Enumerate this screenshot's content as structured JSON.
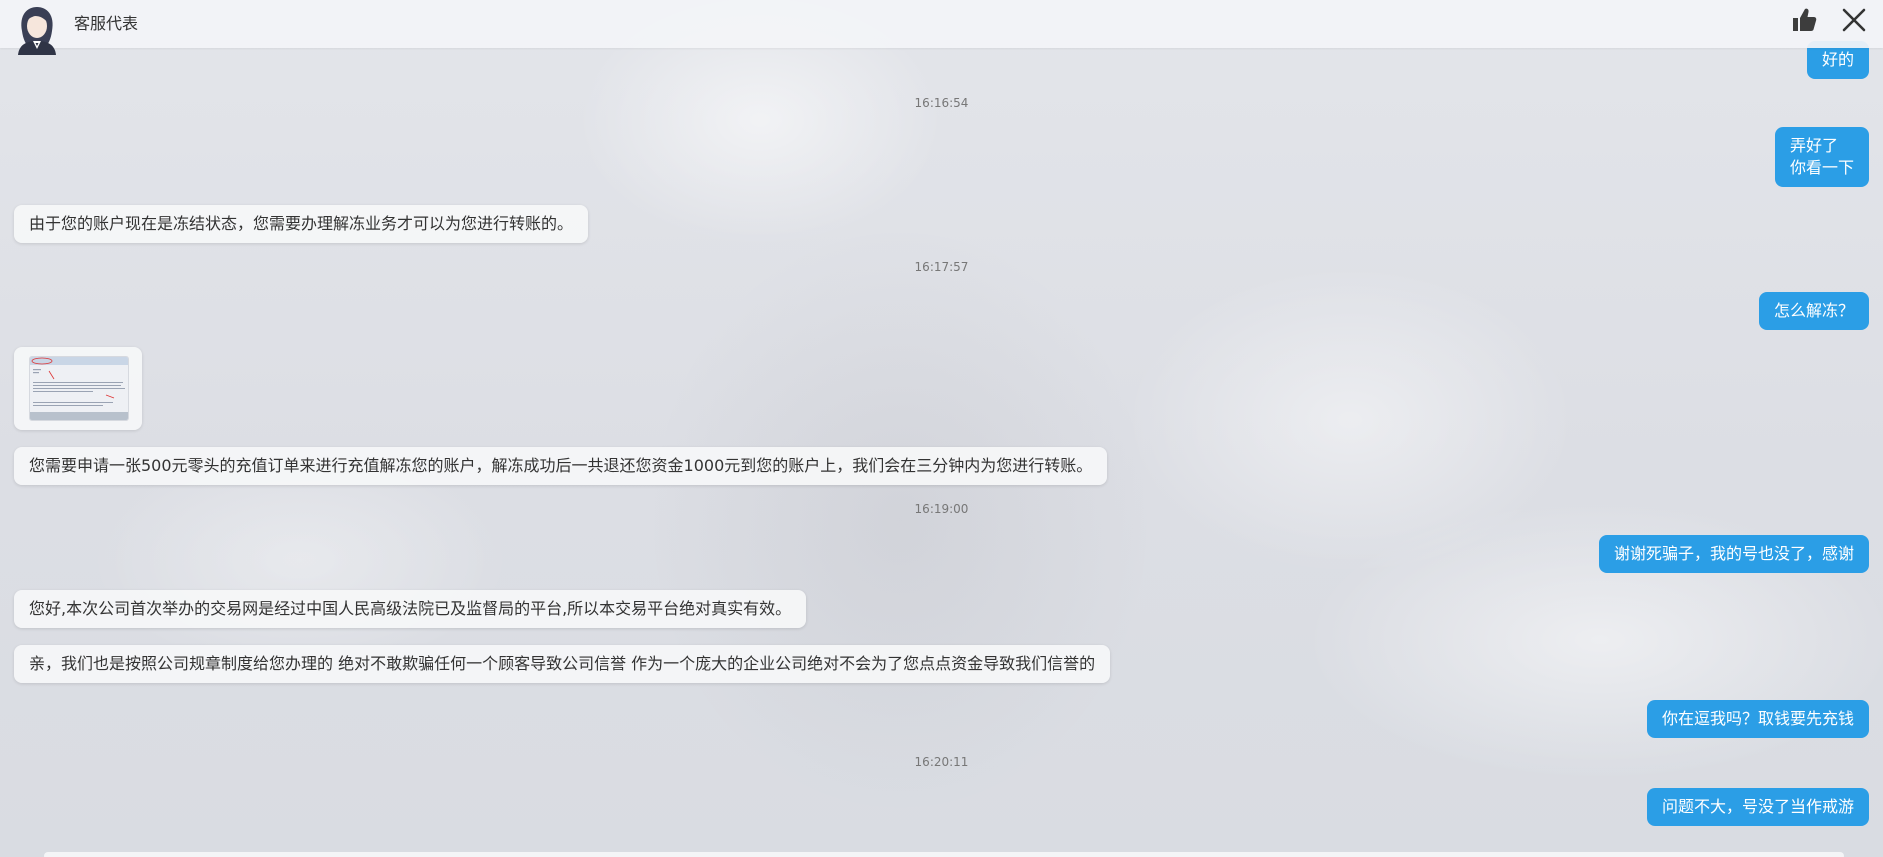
{
  "header": {
    "agent_name": "客服代表"
  },
  "messages": [
    {
      "type": "out",
      "lines": [
        "好的"
      ]
    },
    {
      "type": "time",
      "text": "16:16:54"
    },
    {
      "type": "out",
      "lines": [
        "弄好了",
        "你看一下"
      ]
    },
    {
      "type": "in",
      "lines": [
        "由于您的账户现在是冻结状态，您需要办理解冻业务才可以为您进行转账的。"
      ]
    },
    {
      "type": "time",
      "text": "16:17:57"
    },
    {
      "type": "out",
      "lines": [
        "怎么解冻？"
      ]
    },
    {
      "type": "in-image"
    },
    {
      "type": "in",
      "lines": [
        "您需要申请一张500元零头的充值订单来进行充值解冻您的账户，解冻成功后一共退还您资金1000元到您的账户上，我们会在三分钟内为您进行转账。"
      ]
    },
    {
      "type": "time",
      "text": "16:19:00"
    },
    {
      "type": "out",
      "lines": [
        "谢谢死骗子，我的号也没了，感谢"
      ]
    },
    {
      "type": "in",
      "lines": [
        "您好,本次公司首次举办的交易网是经过中国人民高级法院已及监督局的平台,所以本交易平台绝对真实有效。"
      ]
    },
    {
      "type": "in",
      "lines": [
        "亲，我们也是按照公司规章制度给您办理的 绝对不敢欺骗任何一个顾客导致公司信誉 作为一个庞大的企业公司绝对不会为了您点点资金导致我们信誉的"
      ]
    },
    {
      "type": "out",
      "lines": [
        "你在逗我吗？取钱要先充钱"
      ]
    },
    {
      "type": "time",
      "text": "16:20:11"
    },
    {
      "type": "out",
      "lines": [
        "问题不大，号没了当作戒游"
      ]
    }
  ],
  "colors": {
    "outgoing_bubble": "#2b9ee6",
    "incoming_bubble": "#f5f6f8"
  },
  "icons": {
    "avatar": "agent-avatar",
    "like": "thumbs-up-icon",
    "close": "close-icon"
  }
}
